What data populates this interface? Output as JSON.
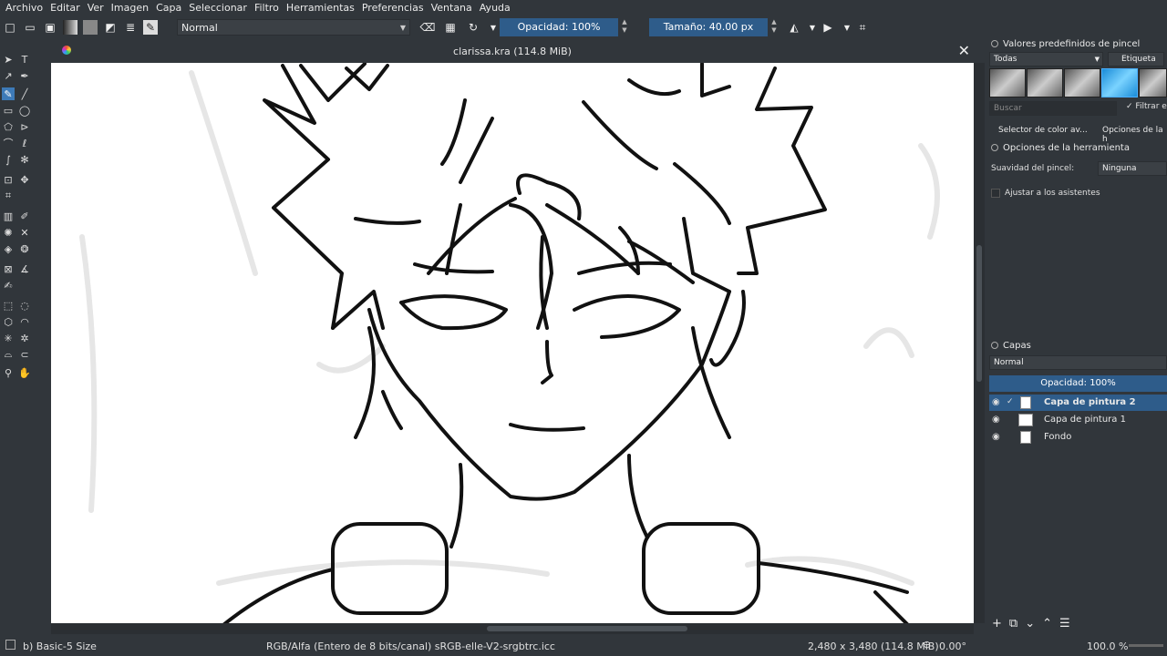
{
  "menu": [
    "Archivo",
    "Editar",
    "Ver",
    "Imagen",
    "Capa",
    "Seleccionar",
    "Filtro",
    "Herramientas",
    "Preferencias",
    "Ventana",
    "Ayuda"
  ],
  "toolbar": {
    "blend_mode": "Normal",
    "opacity_label": "Opacidad: 100%",
    "size_label": "Tamaño: 40.00 px"
  },
  "canvas": {
    "title": "clarissa.kra (114.8 MiB)"
  },
  "brush_presets": {
    "title": "Valores predefinidos de pincel",
    "filter": "Todas",
    "tag": "Etiqueta",
    "search_placeholder": "Buscar",
    "filter_check": "Filtrar e"
  },
  "tool_options": {
    "tab1": "Selector de color av...",
    "tab2": "Opciones de la h",
    "title": "Opciones de la herramienta",
    "smoothing_label": "Suavidad del pincel:",
    "smoothing_value": "Ninguna",
    "snap_label": "Ajustar a los asistentes"
  },
  "layers": {
    "title": "Capas",
    "blend": "Normal",
    "opacity": "Opacidad:  100%",
    "items": [
      {
        "name": "Capa de pintura 2",
        "selected": true
      },
      {
        "name": "Capa de pintura 1",
        "selected": false
      },
      {
        "name": "Fondo",
        "selected": false
      }
    ]
  },
  "status": {
    "brush": "b) Basic-5 Size",
    "color_profile": "RGB/Alfa (Entero de 8 bits/canal)  sRGB-elle-V2-srgbtrc.icc",
    "dimensions": "2,480 x 3,480 (114.8 MiB)",
    "rotation": "0.00°",
    "zoom": "100.0 %"
  }
}
